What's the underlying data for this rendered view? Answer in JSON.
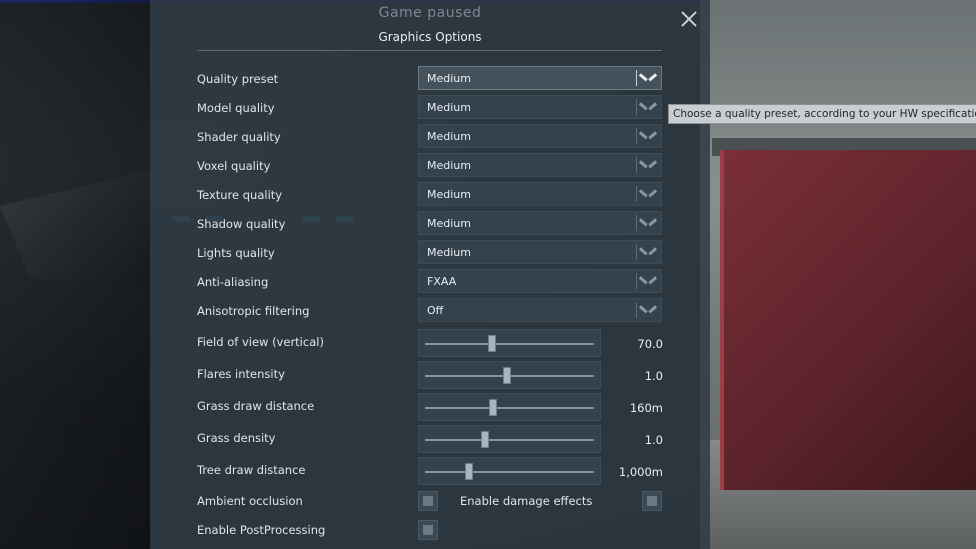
{
  "window": {
    "title": "Game paused",
    "section_title": "Graphics Options",
    "close_icon": "close-icon"
  },
  "dropdowns": [
    {
      "label": "Quality preset",
      "value": "Medium",
      "active": true
    },
    {
      "label": "Model quality",
      "value": "Medium"
    },
    {
      "label": "Shader quality",
      "value": "Medium"
    },
    {
      "label": "Voxel quality",
      "value": "Medium"
    },
    {
      "label": "Texture quality",
      "value": "Medium"
    },
    {
      "label": "Shadow quality",
      "value": "Medium"
    },
    {
      "label": "Lights quality",
      "value": "Medium"
    },
    {
      "label": "Anti-aliasing",
      "value": "FXAA"
    },
    {
      "label": "Anisotropic filtering",
      "value": "Off"
    }
  ],
  "sliders": [
    {
      "label": "Field of view (vertical)",
      "value": "70.0",
      "level": 0.39
    },
    {
      "label": "Flares intensity",
      "value": "1.0",
      "level": 0.48
    },
    {
      "label": "Grass draw distance",
      "value": "160m",
      "level": 0.4
    },
    {
      "label": "Grass density",
      "value": "1.0",
      "level": 0.35
    },
    {
      "label": "Tree draw distance",
      "value": "1,000m",
      "level": 0.26
    }
  ],
  "checkboxes": {
    "ambient_occlusion": {
      "label": "Ambient occlusion",
      "checked": false
    },
    "enable_damage_effects": {
      "label": "Enable damage effects",
      "checked": false
    },
    "enable_postprocessing": {
      "label": "Enable PostProcessing",
      "checked": false
    }
  },
  "tooltip": "Choose a quality preset, according to your HW specifications",
  "colors": {
    "panel": "#2e3a44",
    "accent_crate": "#7a2f38"
  }
}
